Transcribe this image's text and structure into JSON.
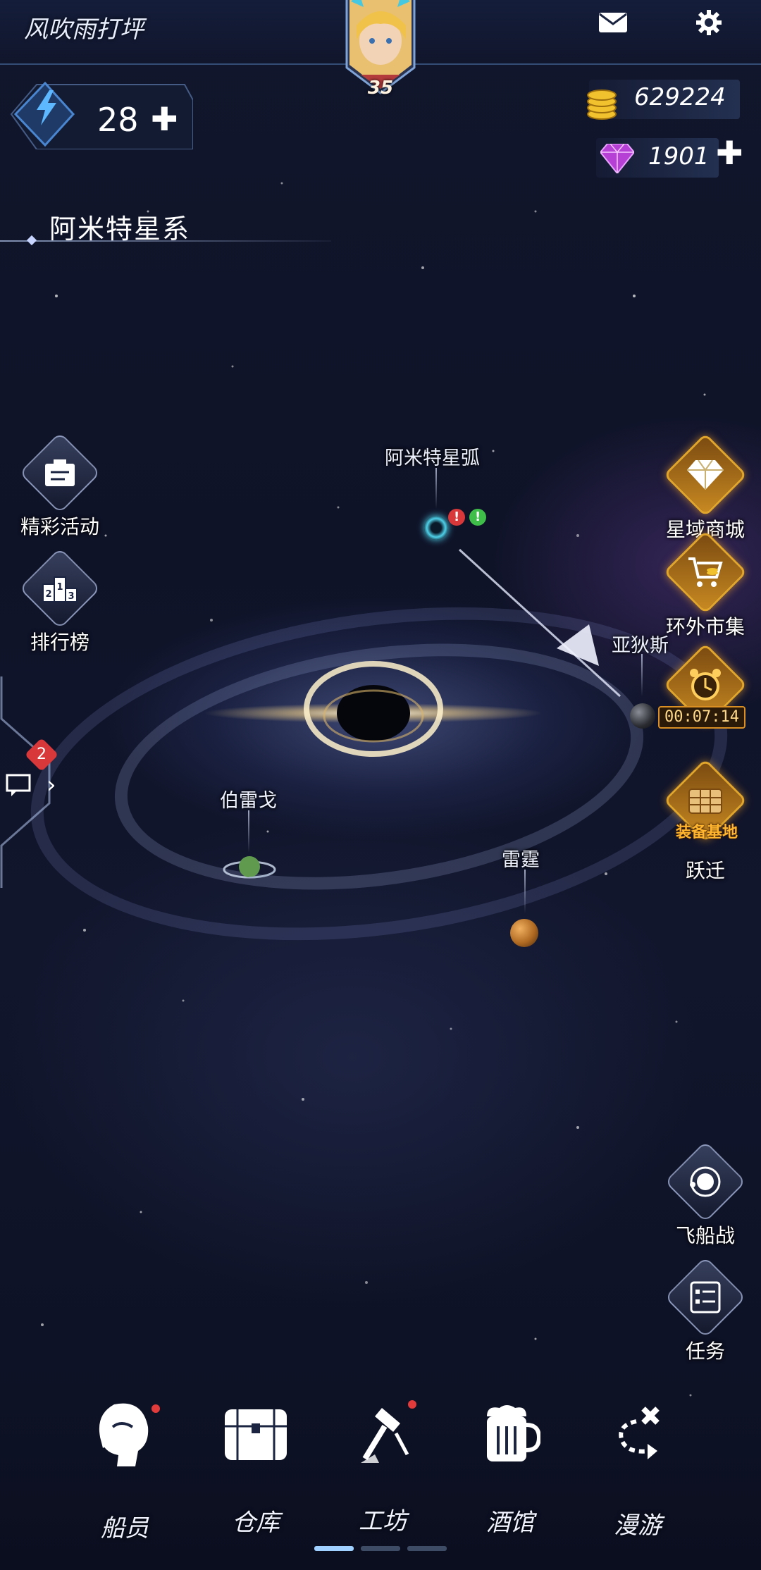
{
  "player": {
    "name": "风吹雨打坪",
    "level": "35"
  },
  "energy": {
    "value": "28"
  },
  "currency": {
    "gold": "629224",
    "gems": "1901"
  },
  "system": {
    "name": "阿米特星系"
  },
  "left_menu": [
    {
      "label": "精彩活动",
      "icon": "event-board-icon"
    },
    {
      "label": "排行榜",
      "icon": "podium-icon"
    }
  ],
  "right_menu": {
    "shop": "星域商城",
    "market": "环外市集",
    "timer": "00:07:14",
    "base_label": "装备基地",
    "warp": "跃迁",
    "ship_battle": "飞船战",
    "tasks": "任务"
  },
  "podium_numbers": [
    "2",
    "1",
    "3"
  ],
  "chat": {
    "badge": "2"
  },
  "planets": {
    "arc": "阿米特星弧",
    "yadis": "亚狄斯",
    "bolego": "伯雷戈",
    "leiting": "雷霆"
  },
  "alerts": {
    "red": "!",
    "green": "!"
  },
  "bottom_nav": [
    {
      "label": "船员",
      "icon": "crew-head-icon",
      "dot": true
    },
    {
      "label": "仓库",
      "icon": "storage-chest-icon",
      "dot": false
    },
    {
      "label": "工坊",
      "icon": "hammer-workshop-icon",
      "dot": true
    },
    {
      "label": "酒馆",
      "icon": "beer-mug-icon",
      "dot": false
    },
    {
      "label": "漫游",
      "icon": "roam-path-icon",
      "dot": false
    }
  ],
  "colors": {
    "accent_gold": "#d98f23",
    "alert_red": "#d9383a",
    "alert_green": "#3fbf4a",
    "gem_purple": "#b63fd6"
  }
}
